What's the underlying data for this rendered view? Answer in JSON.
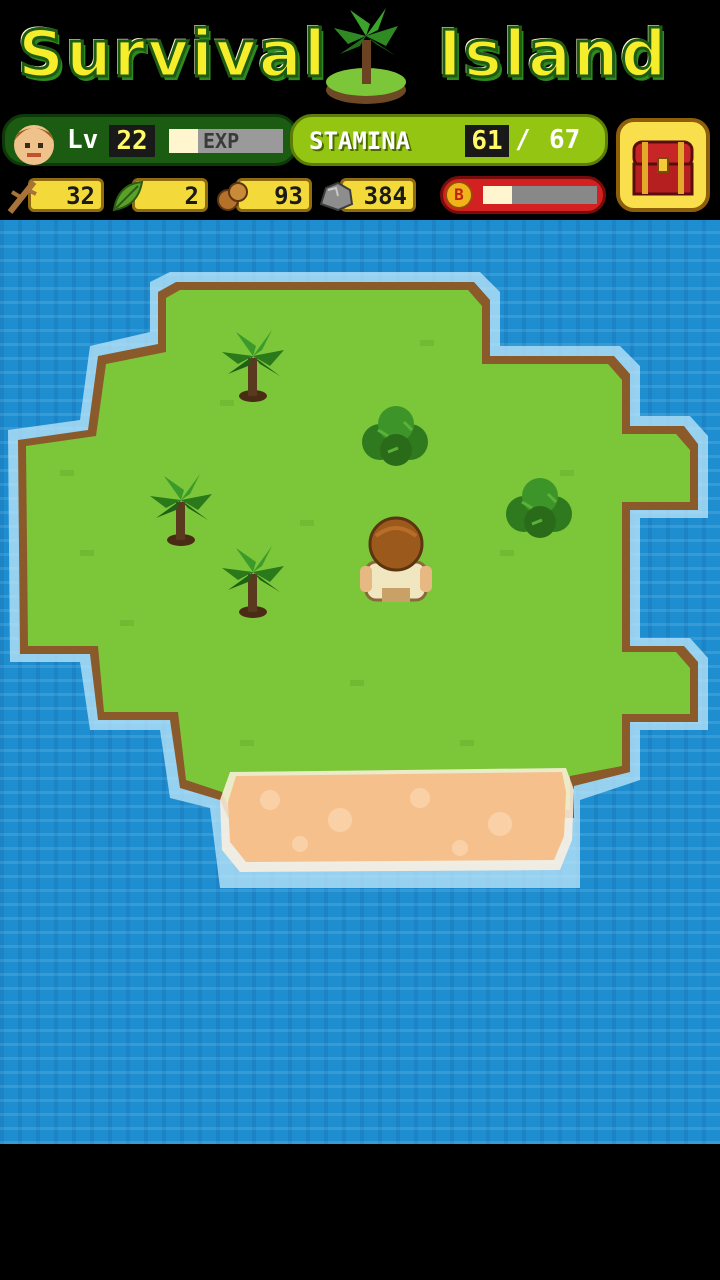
{
  "title": {
    "word1": "Survival",
    "word2": "Island"
  },
  "hud": {
    "level_label": "Lv",
    "level": "22",
    "exp_label": "EXP",
    "exp_progress": 0.25,
    "stamina_label": "STAMINA",
    "stamina_current": "61",
    "stamina_separator": "/",
    "stamina_max": "67",
    "boost_label": "B",
    "boost_progress": 0.25
  },
  "resources": [
    {
      "icon": "branch-icon",
      "value": "32"
    },
    {
      "icon": "leaf-icon",
      "value": "2"
    },
    {
      "icon": "nut-icon",
      "value": "93"
    },
    {
      "icon": "stone-icon",
      "value": "384"
    }
  ],
  "colors": {
    "ocean": "#1f8ed0",
    "grass": "#7cc63a",
    "sand": "#f6c08c",
    "title_text": "#f6ee2b"
  }
}
